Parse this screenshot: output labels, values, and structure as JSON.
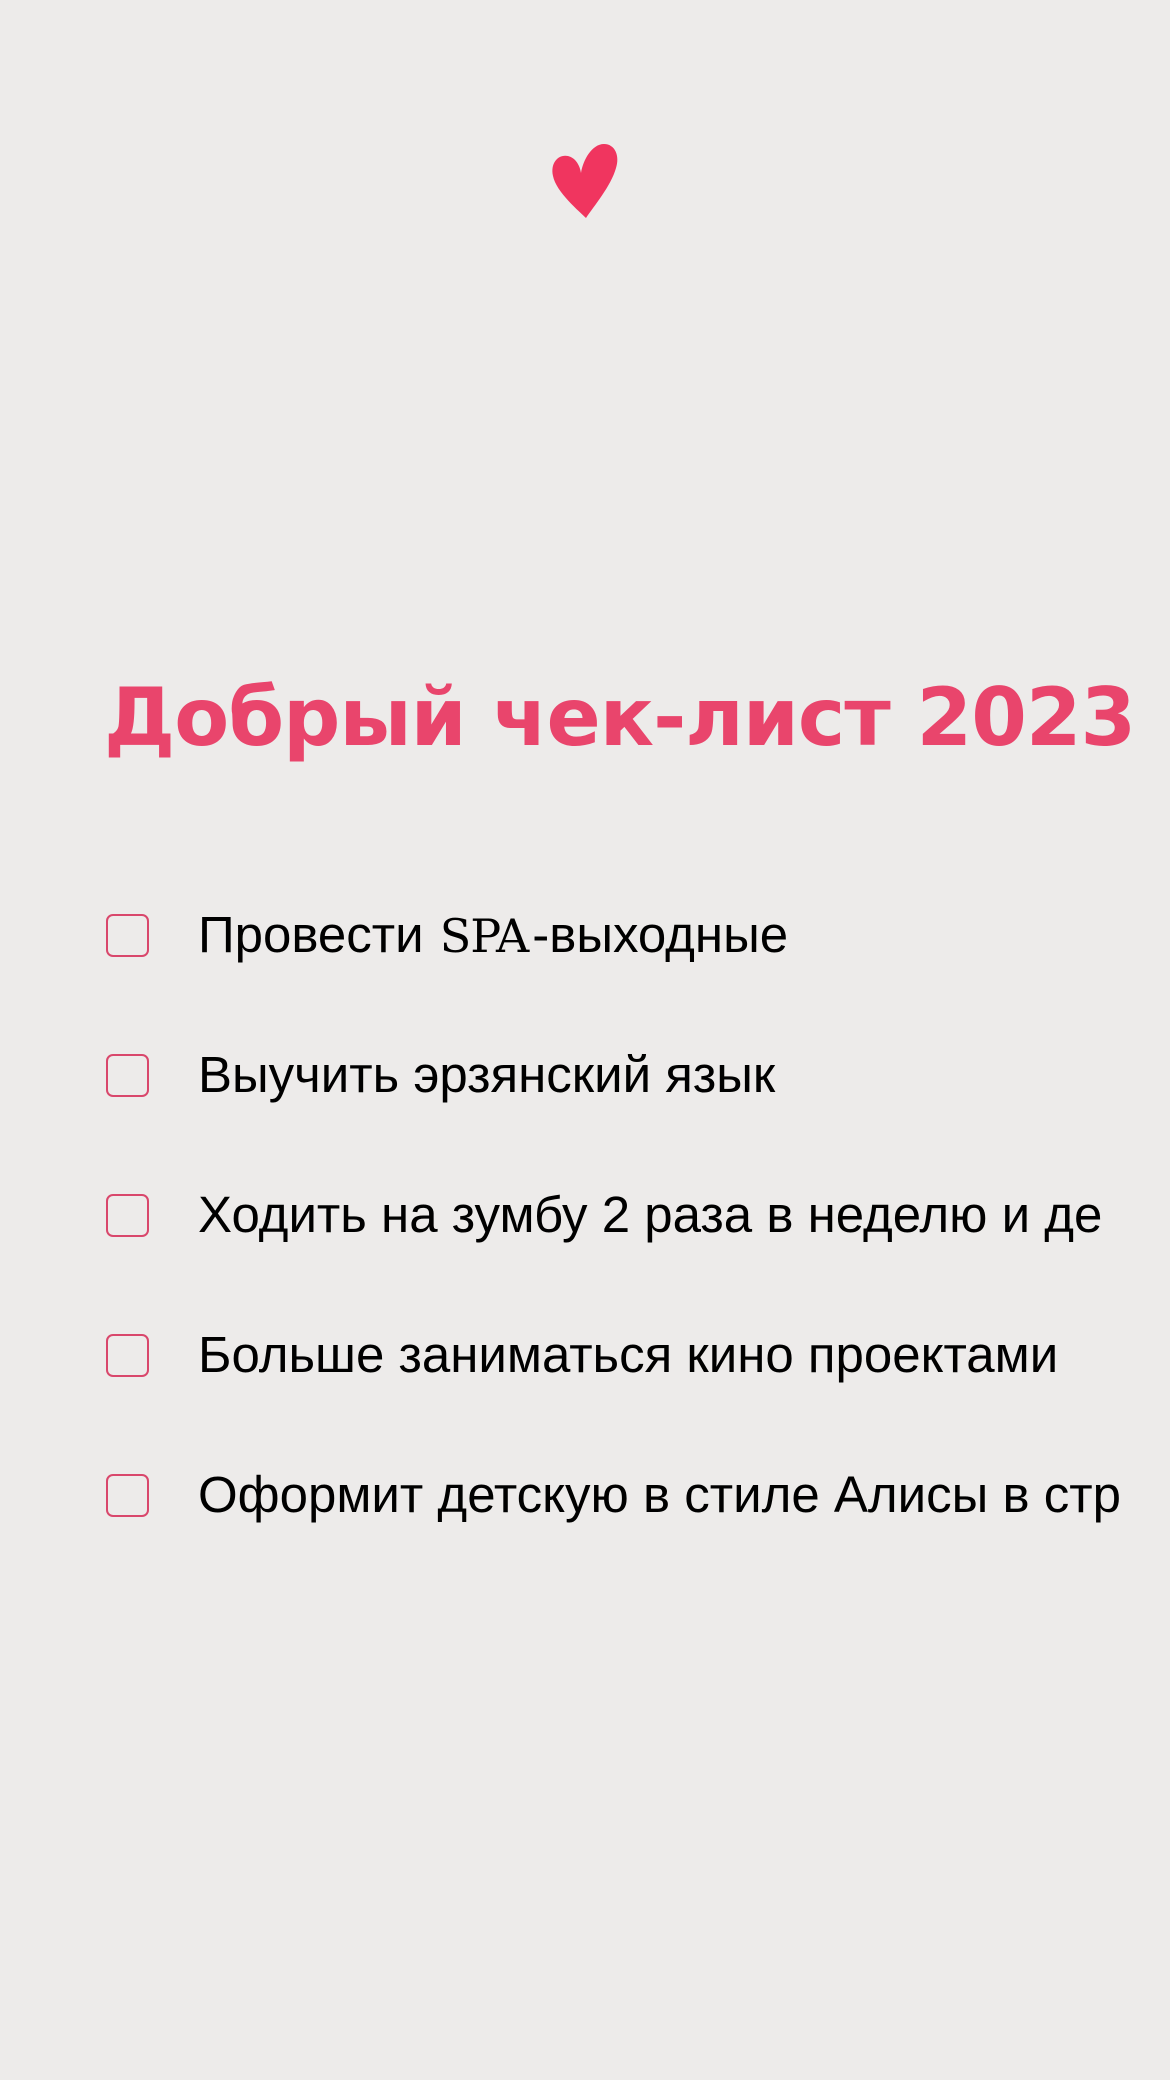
{
  "colors": {
    "background": "#edebea",
    "accent": "#e9456c",
    "heart": "#f0355f",
    "text": "#000000"
  },
  "header": {
    "icon": "heart-icon",
    "title": "Добрый чек-лист 2023"
  },
  "checklist": {
    "items": [
      {
        "before": "Провести ",
        "spa": "SPA",
        "after": "-выходные",
        "checked": false
      },
      {
        "label": "Выучить эрзянский язык",
        "checked": false
      },
      {
        "label": "Ходить на зумбу 2 раза в неделю и де",
        "checked": false
      },
      {
        "label": "Больше заниматься кино проектами",
        "checked": false
      },
      {
        "label": "Оформит детскую в стиле Алисы в стр",
        "checked": false
      }
    ]
  }
}
